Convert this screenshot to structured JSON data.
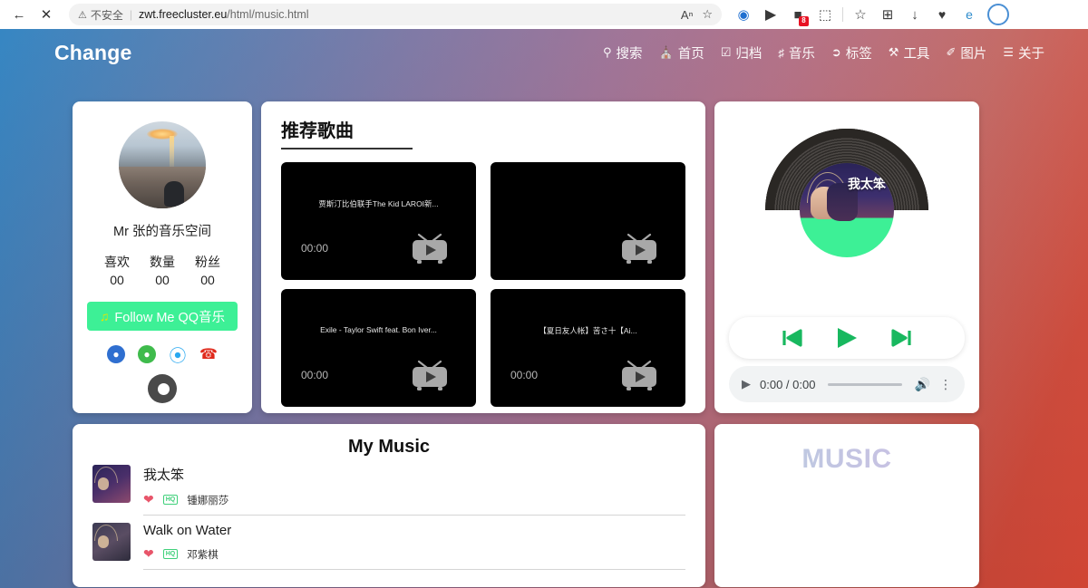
{
  "browser": {
    "back_icon": "back-arrow-icon",
    "close_icon": "close-icon",
    "security_label": "不安全",
    "url_host": "zwt.freecluster.eu",
    "url_path": "/html/music.html",
    "read_aloud_icon": "read-aloud-icon",
    "favorites_add_icon": "add-favorite-icon",
    "toolbar_icons": [
      {
        "name": "browser-essentials-icon",
        "glyph": "●"
      },
      {
        "name": "media-play-icon",
        "glyph": "▶"
      },
      {
        "name": "extension-badge-icon",
        "glyph": "■",
        "badge": "8"
      },
      {
        "name": "split-screen-icon",
        "glyph": "⬚"
      },
      {
        "name": "favorites-icon",
        "glyph": "☆"
      },
      {
        "name": "collections-icon",
        "glyph": "⊞"
      },
      {
        "name": "downloads-icon",
        "glyph": "↓"
      },
      {
        "name": "health-icon",
        "glyph": "♥"
      },
      {
        "name": "ie-mode-icon",
        "glyph": "e"
      }
    ]
  },
  "site": {
    "brand": "Change",
    "nav": [
      {
        "label": "搜索",
        "icon": "search-icon",
        "glyph": "⚲"
      },
      {
        "label": "首页",
        "icon": "home-icon",
        "glyph": "⌂"
      },
      {
        "label": "归档",
        "icon": "archive-icon",
        "glyph": "☑"
      },
      {
        "label": "音乐",
        "icon": "music-note-icon",
        "glyph": "♪"
      },
      {
        "label": "标签",
        "icon": "tag-icon",
        "glyph": "⚑"
      },
      {
        "label": "工具",
        "icon": "tools-icon",
        "glyph": "⚒"
      },
      {
        "label": "图片",
        "icon": "image-icon",
        "glyph": "✐"
      },
      {
        "label": "关于",
        "icon": "about-icon",
        "glyph": "☰"
      }
    ]
  },
  "profile": {
    "avatar_alt": "avatar-sunset-photo",
    "name": "Mr 张的音乐空间",
    "stats": [
      {
        "label": "喜欢",
        "value": "00"
      },
      {
        "label": "数量",
        "value": "00"
      },
      {
        "label": "粉丝",
        "value": "00"
      }
    ],
    "follow_button": "Follow Me QQ音乐",
    "follow_icon": "music-note-icon",
    "socials": [
      {
        "name": "github-icon",
        "glyph": "●"
      },
      {
        "name": "wechat-icon",
        "glyph": "●"
      },
      {
        "name": "qq-icon",
        "glyph": "●"
      },
      {
        "name": "phone-icon",
        "glyph": "☎"
      }
    ],
    "eye_icon": "eye-icon"
  },
  "recommended": {
    "title": "推荐歌曲",
    "videos": [
      {
        "title": "贾斯汀比伯联手The Kid LAROI新...",
        "time": "00:00",
        "icon": "tv-play-icon"
      },
      {
        "title": "",
        "time": "",
        "icon": "tv-play-icon"
      },
      {
        "title": "Exile - Taylor Swift feat. Bon Iver...",
        "time": "00:00",
        "icon": "tv-play-icon"
      },
      {
        "title": "【夏日友人帐】苦さ十【Ai...",
        "time": "00:00",
        "icon": "tv-play-icon"
      }
    ]
  },
  "player": {
    "album_title_cn": "我太笨",
    "prev_icon": "skip-previous-icon",
    "play_icon": "play-icon",
    "next_icon": "skip-next-icon",
    "audio": {
      "play_icon": "play-icon",
      "time": "0:00 / 0:00",
      "volume_icon": "volume-icon",
      "menu_icon": "more-vertical-icon"
    }
  },
  "my_music": {
    "title": "My Music",
    "items": [
      {
        "song": "我太笨",
        "artist": "锺娜丽莎",
        "quality": "HQ",
        "like_icon": "heart-icon"
      },
      {
        "song": "Walk on Water",
        "artist": "邓紫棋",
        "quality": "HQ",
        "like_icon": "heart-icon"
      }
    ]
  },
  "music_panel": {
    "word": "MUSIC"
  },
  "colors": {
    "gradient_start": "#2a7fbf",
    "gradient_end": "#e04a38",
    "accent_green": "#3df096",
    "player_green": "#18b85f",
    "heart_red": "#e8556a"
  }
}
